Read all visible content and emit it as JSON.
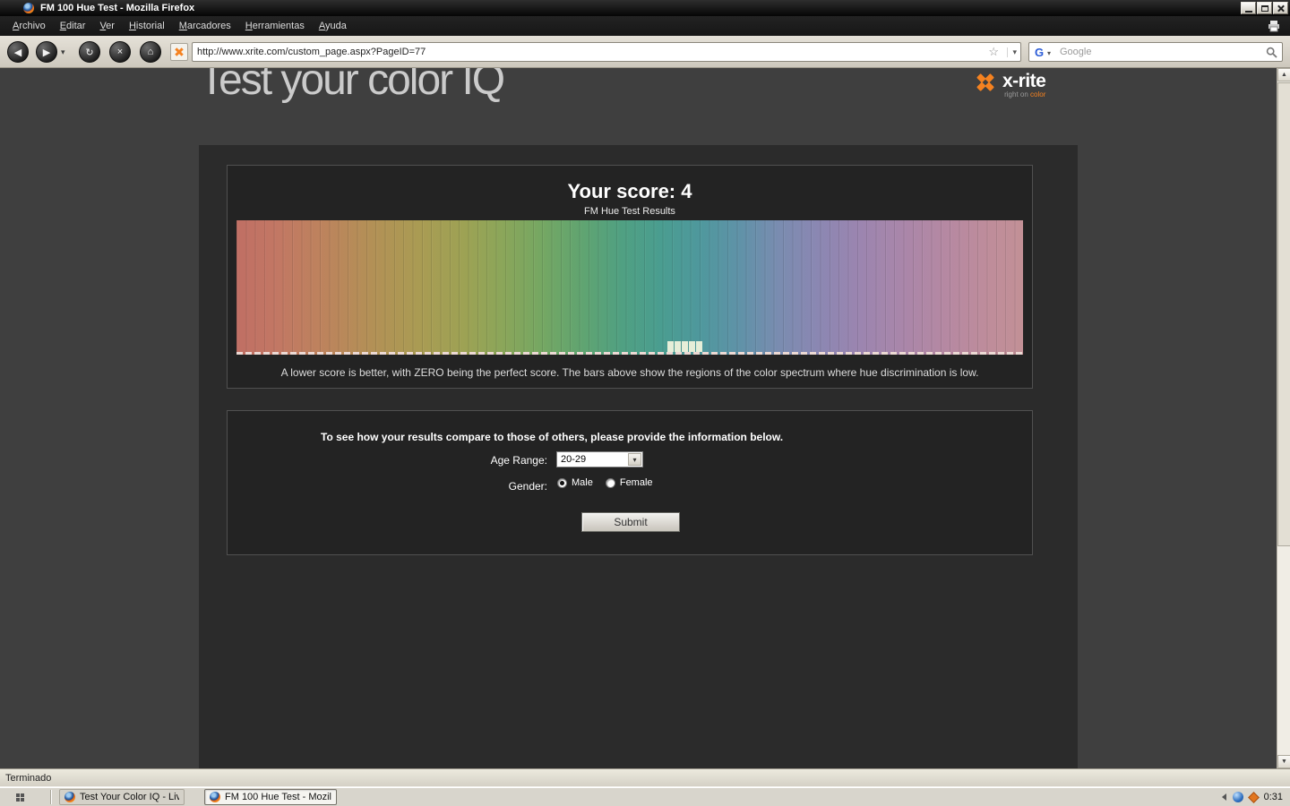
{
  "window": {
    "title": "FM 100 Hue Test - Mozilla Firefox"
  },
  "menubar": {
    "items": [
      "Archivo",
      "Editar",
      "Ver",
      "Historial",
      "Marcadores",
      "Herramientas",
      "Ayuda"
    ]
  },
  "navbar": {
    "url": "http://www.xrite.com/custom_page.aspx?PageID=77",
    "search_placeholder": "Google"
  },
  "icons": {
    "back": "◀",
    "forward": "▶",
    "dropdown_caret": "▾",
    "reload": "↻",
    "stop": "×",
    "home": "⌂",
    "star": "☆",
    "google_g": "G",
    "scroll_up": "▲",
    "scroll_down": "▼"
  },
  "page": {
    "heading": "Test your color IQ",
    "logo": {
      "brand": "x-rite",
      "tagline_prefix": "right on ",
      "tagline_accent": "color",
      "accent_color": "#f58220"
    },
    "score": {
      "title": "Your score: 4",
      "subtitle": "FM Hue Test Results",
      "caption": "A lower score is better, with ZERO being the perfect score. The bars above show the regions of the color spectrum where hue discrimination is low."
    },
    "spectrum": {
      "stops": [
        {
          "pos": 0,
          "color": "#c06f64"
        },
        {
          "pos": 5,
          "color": "#c27764"
        },
        {
          "pos": 11,
          "color": "#bd835d"
        },
        {
          "pos": 17,
          "color": "#b39056"
        },
        {
          "pos": 23,
          "color": "#aa9b53"
        },
        {
          "pos": 29,
          "color": "#9da254"
        },
        {
          "pos": 34,
          "color": "#8aa65a"
        },
        {
          "pos": 39,
          "color": "#74a763"
        },
        {
          "pos": 44,
          "color": "#60a471"
        },
        {
          "pos": 49,
          "color": "#50a082"
        },
        {
          "pos": 54,
          "color": "#4a9d90"
        },
        {
          "pos": 59,
          "color": "#4f989d"
        },
        {
          "pos": 64,
          "color": "#6092a8"
        },
        {
          "pos": 69,
          "color": "#7a8cb0"
        },
        {
          "pos": 74,
          "color": "#8b87b2"
        },
        {
          "pos": 79,
          "color": "#9b85b0"
        },
        {
          "pos": 85,
          "color": "#aa86a9"
        },
        {
          "pos": 91,
          "color": "#b789a1"
        },
        {
          "pos": 96,
          "color": "#bf8d9a"
        },
        {
          "pos": 100,
          "color": "#c29096"
        }
      ],
      "error_bar_positions_pct": [
        54.8,
        55.7,
        56.6,
        57.5,
        58.4
      ]
    },
    "form": {
      "intro": "To see how your results compare to those of others, please provide the information below.",
      "age_label": "Age Range:",
      "age_value": "20-29",
      "gender_label": "Gender:",
      "options": {
        "male": "Male",
        "female": "Female",
        "selected": "male"
      },
      "submit": "Submit"
    }
  },
  "statusbar": {
    "text": "Terminado"
  },
  "taskbar": {
    "buttons": [
      {
        "label": "Test Your Color IQ - Live ...",
        "active": false
      },
      {
        "label": "FM 100 Hue Test - Mozil...",
        "active": true
      }
    ],
    "clock": "0:31"
  }
}
